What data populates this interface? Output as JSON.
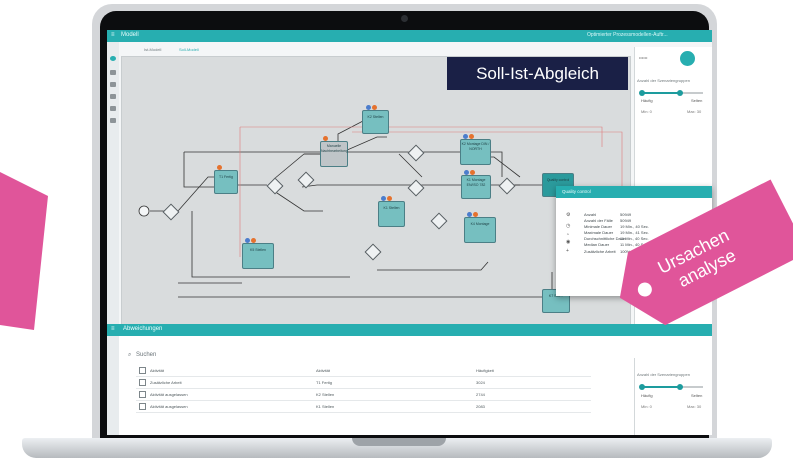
{
  "overlay_label": "Soll-Ist-Abgleich",
  "tag_label": {
    "line1": "Ursachen",
    "line2": "analyse"
  },
  "app": {
    "title": "Modell",
    "top_right": "Optimierter Prozessmodellen-Auftr...",
    "tabs": [
      "Ist-Modell",
      "Soll-Modell"
    ],
    "right_panel": {
      "label": "Anzahl der Szenariengruppen",
      "low": "Häufig",
      "high": "Selten",
      "min": "Min: 0",
      "max": "Max: 30"
    },
    "nodes": [
      {
        "id": "n1",
        "label": "T1 Fertig"
      },
      {
        "id": "n2",
        "label": "K2 Stellen"
      },
      {
        "id": "n3",
        "label": "Manuelle Nachbearbeitung"
      },
      {
        "id": "n4",
        "label": "K2 Montage DIN / NORTH"
      },
      {
        "id": "n5",
        "label": "K1 Montage EN/ISO 782"
      },
      {
        "id": "n6",
        "label": "K1 Stellen"
      },
      {
        "id": "n7",
        "label": "K4 Montage"
      },
      {
        "id": "n8",
        "label": "K5 Stellen"
      },
      {
        "id": "n9",
        "label": "Quality control"
      },
      {
        "id": "n10",
        "label": "K7 Stel..."
      }
    ]
  },
  "quality_popup": {
    "title": "Quality control",
    "rows": [
      {
        "k": "Anzahl",
        "v": "50949"
      },
      {
        "k": "Anzahl der Fälle",
        "v": "50949"
      },
      {
        "k": "Minimale Dauer",
        "v": "19 Min., 40 Sec."
      },
      {
        "k": "Maximale Dauer",
        "v": "19 Min., 41 Sec."
      },
      {
        "k": "Durchschnittliche Dauer",
        "v": "11 Min., 40 Sec."
      },
      {
        "k": "Median Dauer",
        "v": "11 Min., 40 Sec."
      },
      {
        "k": "Zusätzliche Arbeit",
        "v": "100%"
      }
    ]
  },
  "bottom": {
    "title": "Abweichungen",
    "search_placeholder": "Suchen",
    "headers": [
      "Aktivität",
      "Aktivität",
      "Häufigkeit"
    ],
    "rows": [
      {
        "c1": "Zusätzliche Arbeit",
        "c2": "T1 Fertig",
        "c3": "3024"
      },
      {
        "c1": "Aktivität ausgelassen",
        "c2": "K2 Stellen",
        "c3": "2744"
      },
      {
        "c1": "Aktivität ausgelassen",
        "c2": "K1 Stellen",
        "c3": "2083"
      }
    ],
    "right_panel": {
      "label": "Anzahl der Szenariengruppen",
      "low": "Häufig",
      "high": "Selten",
      "min": "Min: 0",
      "max": "Max: 30"
    }
  },
  "colors": {
    "accent": "#27aeb0",
    "overlay": "#1a2046",
    "tag": "#e0559a"
  }
}
